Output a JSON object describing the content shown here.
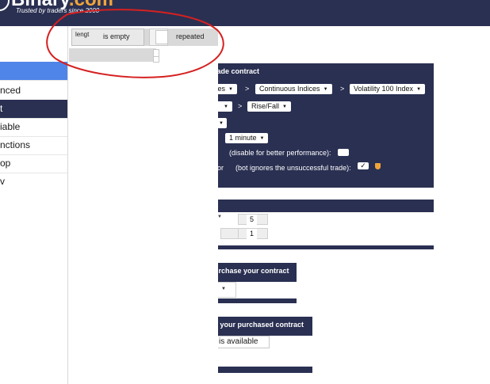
{
  "header": {
    "logo_main": "Binary",
    "logo_suffix": ".com",
    "tagline": "Trusted by traders since 2000"
  },
  "sidebar": {
    "items": [
      {
        "label": "",
        "active": true
      },
      {
        "label": "nced"
      },
      {
        "label": "t",
        "active_dark": true
      },
      {
        "label": "iable"
      },
      {
        "label": "nctions"
      },
      {
        "label": "op"
      },
      {
        "label": "v"
      }
    ]
  },
  "flyout": {
    "lengt_label": "lengt",
    "is_empty_label": "is empty",
    "repeated_label": "repeated"
  },
  "trade_block": {
    "title": "rade contract",
    "market_partial": "ces",
    "submarket": "Continuous Indices",
    "symbol": "Volatility 100 Index",
    "trade_type": "Rise/Fall",
    "duration_unit": "1 minute",
    "perf_text": "(disable for better performance):",
    "retry_text": "(bot ignores the unsuccessful trade):",
    "r_fragment": "r",
    "or_fragment": "or",
    "arrow": ">"
  },
  "numbers": {
    "num1": "5",
    "num2": "1"
  },
  "purchase_block": {
    "title": "urchase your contract"
  },
  "sell_block": {
    "title": "ll your purchased contract",
    "condition": "l is available"
  },
  "colors": {
    "header": "#2a3052",
    "accent": "#f0a53a",
    "annotation": "#d62020"
  }
}
